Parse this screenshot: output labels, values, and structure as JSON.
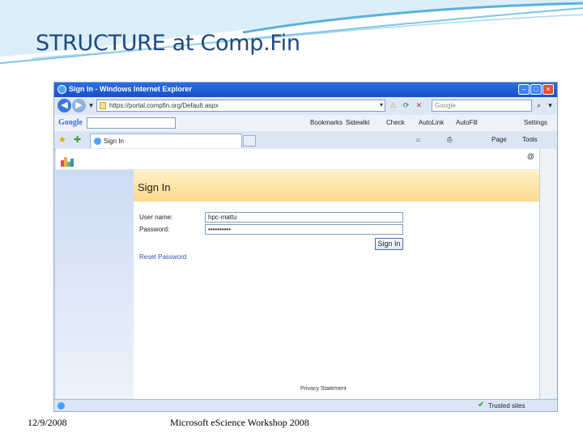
{
  "slide": {
    "title": "STRUCTURE at Comp.Fin",
    "footer_date": "12/9/2008",
    "footer_center": "Microsoft eScience Workshop 2008"
  },
  "browser": {
    "window_title": "Sign In - Windows Internet Explorer",
    "url": "https://portal.compfin.org/Default.aspx",
    "search_placeholder": "Google",
    "google_toolbar": {
      "logo": "Google",
      "items": [
        "Bookmarks",
        "Sidewiki",
        "Check",
        "AutoLink",
        "AutoFill",
        "Settings"
      ]
    },
    "tab_label": "Sign In",
    "command_items": [
      "Page",
      "Tools"
    ],
    "status_text": "Trusted sites"
  },
  "page": {
    "heading": "Sign In",
    "username_label": "User name:",
    "username_value": "hpc-mattu",
    "password_label": "Password:",
    "password_value": "••••••••••",
    "signin_button": "Sign In",
    "reset_link": "Reset Password",
    "privacy": "Privacy Statement"
  },
  "colors": {
    "title_text": "#1f497d",
    "ie_titlebar": "#1950c9",
    "signin_header": "#fbd98b",
    "left_pane": "#ccdcf3"
  }
}
